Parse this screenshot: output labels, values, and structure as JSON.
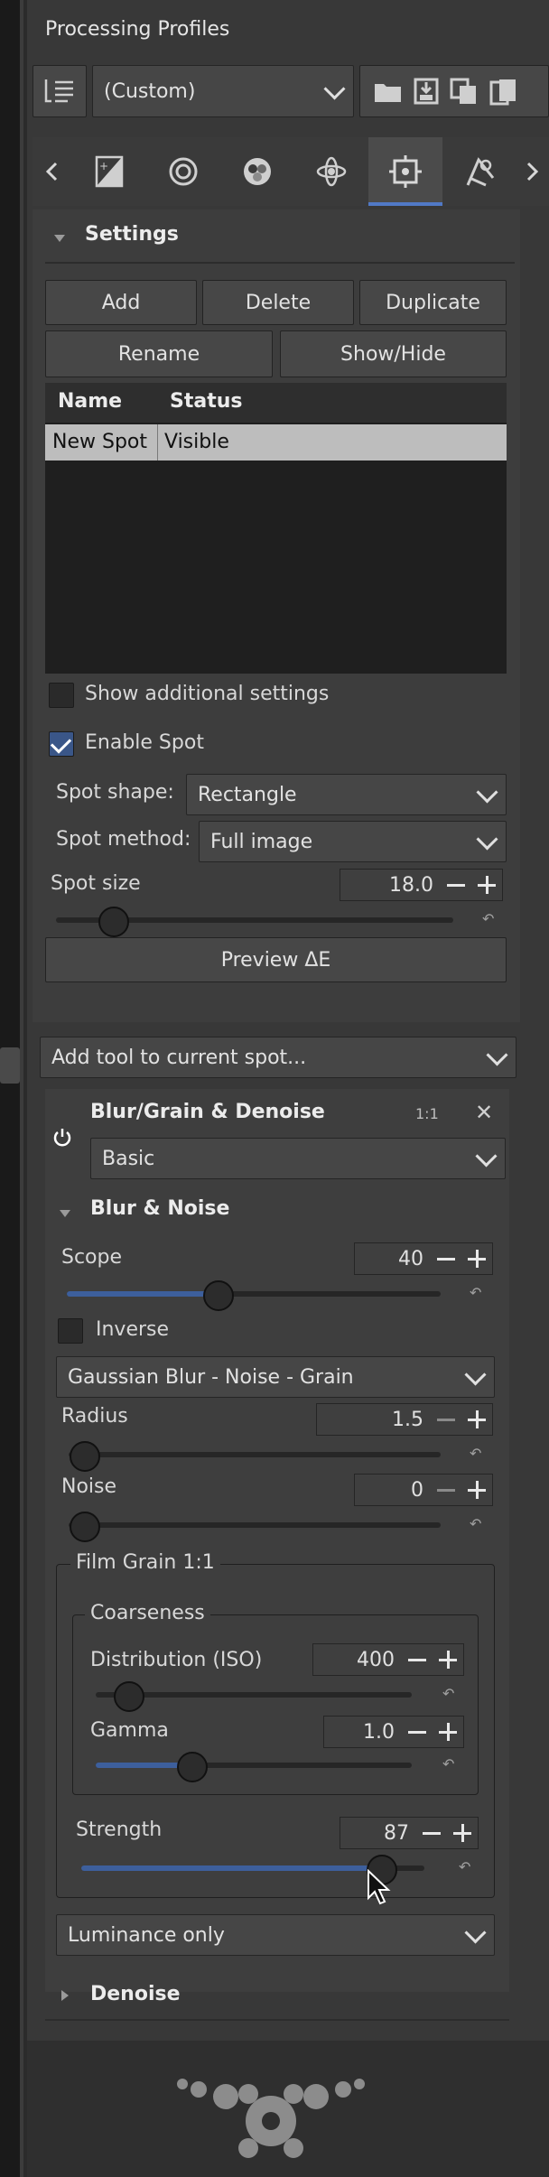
{
  "panel": {
    "title": "Processing Profiles"
  },
  "profile": {
    "combo_value": "(Custom)"
  },
  "icons": [
    "list-icon",
    "folder-icon",
    "save-icon",
    "copy-icon",
    "paste-icon",
    "chevron-left-icon",
    "exposure-icon",
    "detail-icon",
    "color-icon",
    "raw-icon",
    "local-adjust-icon",
    "meta-icon",
    "chevron-right-icon"
  ],
  "settings": {
    "header": "Settings",
    "buttons": {
      "add": "Add",
      "delete": "Delete",
      "duplicate": "Duplicate",
      "rename": "Rename",
      "show_hide": "Show/Hide"
    },
    "table": {
      "columns": [
        "Name",
        "Status"
      ],
      "rows": [
        {
          "name": "New Spot",
          "status": "Visible"
        }
      ]
    },
    "show_additional": {
      "label": "Show additional settings",
      "checked": false
    },
    "enable_spot": {
      "label": "Enable Spot",
      "checked": true
    },
    "spot_shape": {
      "label": "Spot shape:",
      "value": "Rectangle"
    },
    "spot_method": {
      "label": "Spot method:",
      "value": "Full image"
    },
    "spot_size": {
      "label": "Spot size",
      "value": "18.0",
      "fraction": 0.14
    },
    "preview_label": "Preview ΔE"
  },
  "add_tool": {
    "value": "Add tool to current spot..."
  },
  "blur_tool": {
    "title": "Blur/Grain & Denoise",
    "ratio_badge": "1:1",
    "mode": "Basic",
    "blur_noise_header": "Blur & Noise",
    "scope": {
      "label": "Scope",
      "value": "40",
      "fraction": 0.4
    },
    "inverse": {
      "label": "Inverse",
      "checked": false
    },
    "method": "Gaussian Blur - Noise - Grain",
    "radius": {
      "label": "Radius",
      "value": "1.5",
      "fraction": 0.0
    },
    "noise": {
      "label": "Noise",
      "value": "0",
      "fraction": 0.0
    },
    "film_grain": {
      "title": "Film Grain 1:1",
      "coarseness": {
        "title": "Coarseness",
        "distribution": {
          "label": "Distribution (ISO)",
          "value": "400",
          "fraction": 0.1
        },
        "gamma": {
          "label": "Gamma",
          "value": "1.0",
          "fraction": 0.3
        }
      },
      "strength": {
        "label": "Strength",
        "value": "87",
        "fraction": 0.87
      }
    },
    "luminance": "Luminance only",
    "denoise_header": "Denoise"
  },
  "colors": {
    "accent": "#5179c6",
    "slider_fill": "#3d5f9c",
    "panel_bg": "#383838"
  }
}
